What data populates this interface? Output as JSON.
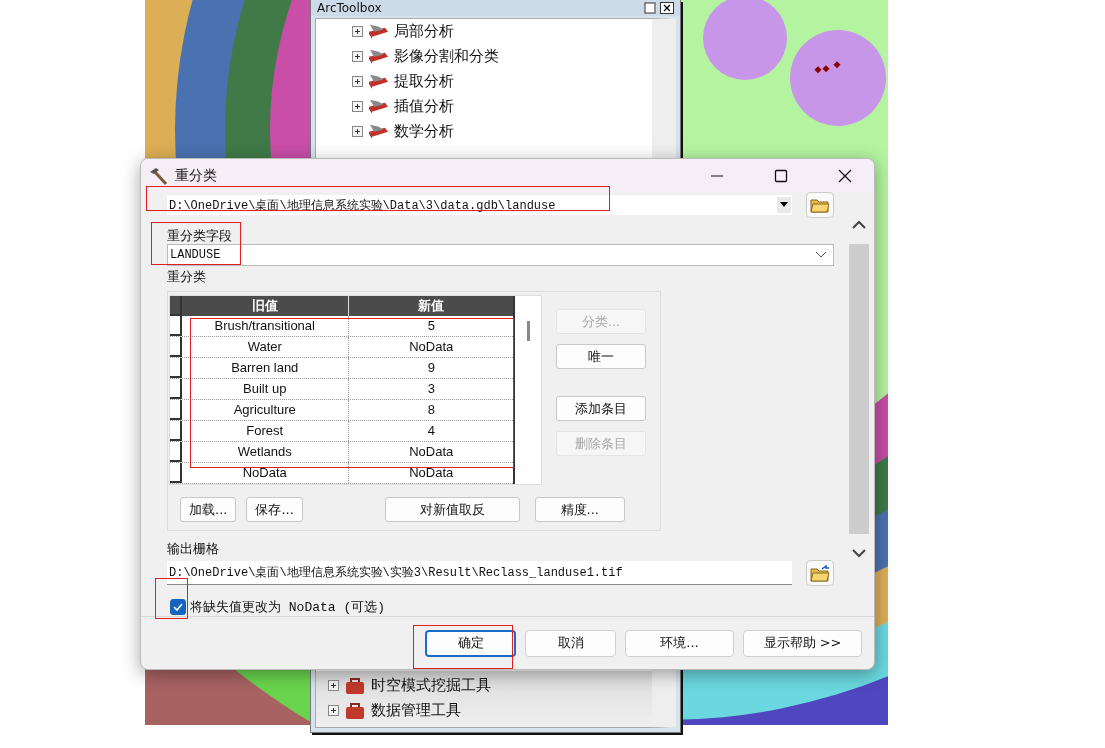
{
  "toolbox": {
    "title": "ArcToolbox",
    "items_top": [
      {
        "label": "局部分析",
        "expanded": false,
        "kind": "toolset"
      },
      {
        "label": "影像分割和分类",
        "expanded": false,
        "kind": "toolset"
      },
      {
        "label": "提取分析",
        "expanded": false,
        "kind": "toolset"
      },
      {
        "label": "插值分析",
        "expanded": false,
        "kind": "toolset"
      },
      {
        "label": "数学分析",
        "expanded": false,
        "kind": "toolset"
      }
    ],
    "items_bottom": [
      {
        "label": "时空模式挖掘工具",
        "expanded": false,
        "kind": "toolbox"
      },
      {
        "label": "数据管理工具",
        "expanded": false,
        "kind": "toolbox"
      }
    ]
  },
  "dialog": {
    "title": "重分类",
    "input_path": "D:\\OneDrive\\桌面\\地理信息系统实验\\Data\\3\\data.gdb\\landuse",
    "field_label": "重分类字段",
    "field_value": "LANDUSE",
    "reclass_label": "重分类",
    "table": {
      "columns": [
        "旧值",
        "新值"
      ],
      "rows": [
        {
          "old": "Brush/transitional",
          "new": "5"
        },
        {
          "old": "Water",
          "new": "NoData"
        },
        {
          "old": "Barren land",
          "new": "9"
        },
        {
          "old": "Built up",
          "new": "3"
        },
        {
          "old": "Agriculture",
          "new": "8"
        },
        {
          "old": "Forest",
          "new": "4"
        },
        {
          "old": "Wetlands",
          "new": "NoData"
        },
        {
          "old": "NoData",
          "new": "NoData"
        }
      ]
    },
    "side_buttons": [
      {
        "label": "分类...",
        "disabled": true
      },
      {
        "label": "唯一",
        "disabled": false
      },
      {
        "label": "添加条目",
        "disabled": false
      },
      {
        "label": "删除条目",
        "disabled": true
      }
    ],
    "table_buttons": [
      "加载...",
      "保存...",
      "对新值取反",
      "精度..."
    ],
    "output_label": "输出栅格",
    "output_path": "D:\\OneDrive\\桌面\\地理信息系统实验\\实验3\\Result\\Reclass_landuse1.tif",
    "missing_option": {
      "label": "将缺失值更改为 NoData (可选)",
      "checked": true
    },
    "footer_buttons": [
      {
        "label": "确定",
        "focused": true
      },
      {
        "label": "取消",
        "focused": false
      },
      {
        "label": "环境...",
        "focused": false
      },
      {
        "label": "显示帮助 >>",
        "focused": false
      }
    ]
  }
}
